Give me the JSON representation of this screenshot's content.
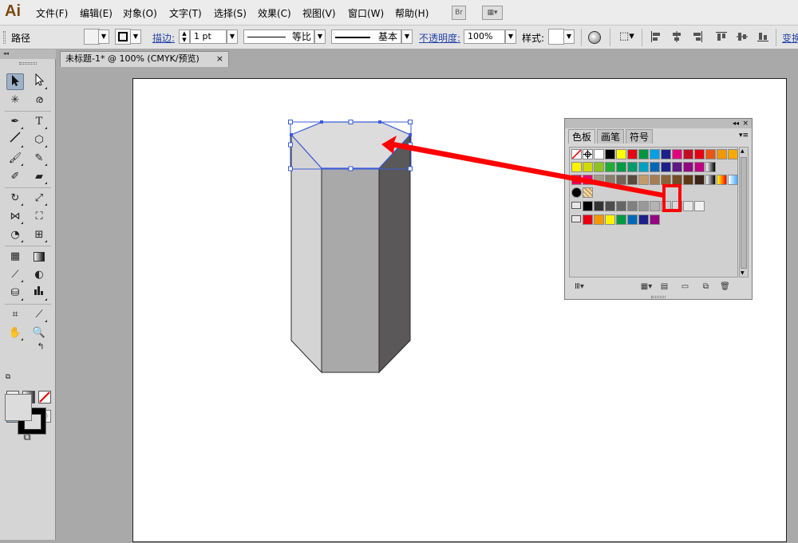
{
  "app": {
    "logo": "Ai"
  },
  "menu": [
    "文件(F)",
    "编辑(E)",
    "对象(O)",
    "文字(T)",
    "选择(S)",
    "效果(C)",
    "视图(V)",
    "窗口(W)",
    "帮助(H)"
  ],
  "top_icons": {
    "bridge": "Br",
    "arrange": "workspace-layout-icon"
  },
  "control": {
    "object_type": "路径",
    "stroke_label": "描边",
    "stroke_weight": "1 pt",
    "profile_label": "等比",
    "brush_label": "基本",
    "opacity_label": "不透明度",
    "opacity_value": "100%",
    "style_label": "样式:",
    "transform_label": "变换"
  },
  "document": {
    "tab_title": "未标题-1* @ 100% (CMYK/预览)",
    "close": "×"
  },
  "tools": {
    "header": "◂◂"
  },
  "swatches": {
    "tabs": [
      "色板",
      "画笔",
      "符号"
    ],
    "menu_glyph": "▾≡",
    "collapse_glyph": "◂◂",
    "close_glyph": "×",
    "colors": {
      "row1": [
        "#ffffff",
        "#000000",
        "#ffff00",
        "#e30613",
        "#009640",
        "#00a0e9",
        "#1d2088",
        "#e4007f",
        "#c30d23",
        "#e60012",
        "#ea5514",
        "#f39800",
        "#f6ab00"
      ],
      "row2": [
        "#fff100",
        "#cfdb00",
        "#8fc31f",
        "#22ac38",
        "#009944",
        "#009b6b",
        "#00a0c1",
        "#0068b7",
        "#1d2088",
        "#601986",
        "#920783",
        "#be0081"
      ],
      "row3": [
        "#e5004f",
        "#e8006f",
        "#a59b8b",
        "#8b7d6b",
        "#736357",
        "#5a4a3c",
        "#c49a6c",
        "#a67c52",
        "#8c6239",
        "#754c24",
        "#603813",
        "#3c2415"
      ],
      "gray_group": [
        "#000000",
        "#333333",
        "#4d4d4d",
        "#666666",
        "#808080",
        "#999999",
        "#b3b3b3",
        "#cccccc",
        "#d9d9d9",
        "#e6e6e6",
        "#f2f2f2"
      ],
      "bright_group": [
        "#e60012",
        "#f39800",
        "#fff100",
        "#009944",
        "#0068b7",
        "#1d2088",
        "#920783"
      ]
    }
  },
  "colors": {
    "accent_red": "#ff0000",
    "selection": "#3a5bd9"
  }
}
